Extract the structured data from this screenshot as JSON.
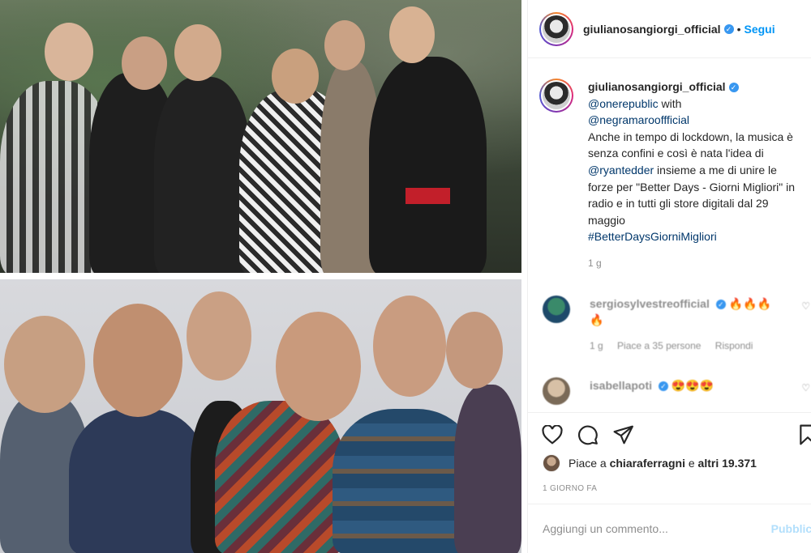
{
  "header": {
    "username": "giulianosangiorgi_official",
    "separator": "•",
    "follow_label": "Segui"
  },
  "caption": {
    "username": "giulianosangiorgi_official",
    "mention1": "@onerepublic",
    "text1": " with",
    "mention2": "@negramarooffficial",
    "text2": "Anche in tempo di lockdown, la musica è senza confini e così è nata l'idea di ",
    "mention3": "@ryantedder",
    "text3": " insieme a me di unire le forze per \"Better Days - Giorni Migliori\" in radio e in tutti gli store digitali dal 29 maggio",
    "hashtag": "#BetterDaysGiorniMigliori",
    "time": "1 g"
  },
  "comments": [
    {
      "username": "sergiosylvestreofficial",
      "text": "🔥🔥🔥🔥",
      "time": "1 g",
      "likes": "Piace a 35 persone",
      "reply": "Rispondi"
    },
    {
      "username": "isabellapoti",
      "text": "😍😍😍"
    }
  ],
  "likes": {
    "prefix": "Piace a ",
    "user": "chiaraferragni",
    "middle": " e ",
    "others": "altri 19.371"
  },
  "timestamp": "1 GIORNO FA",
  "add_comment": {
    "placeholder": "Aggiungi un commento...",
    "publish_label": "Pubblica"
  },
  "icons": [
    "verified-badge",
    "heart-icon",
    "comment-icon",
    "share-icon",
    "bookmark-icon"
  ],
  "colors": {
    "link": "#00376b",
    "follow": "#0095f6",
    "verified": "#3897f0",
    "muted": "#8e8e8e"
  }
}
